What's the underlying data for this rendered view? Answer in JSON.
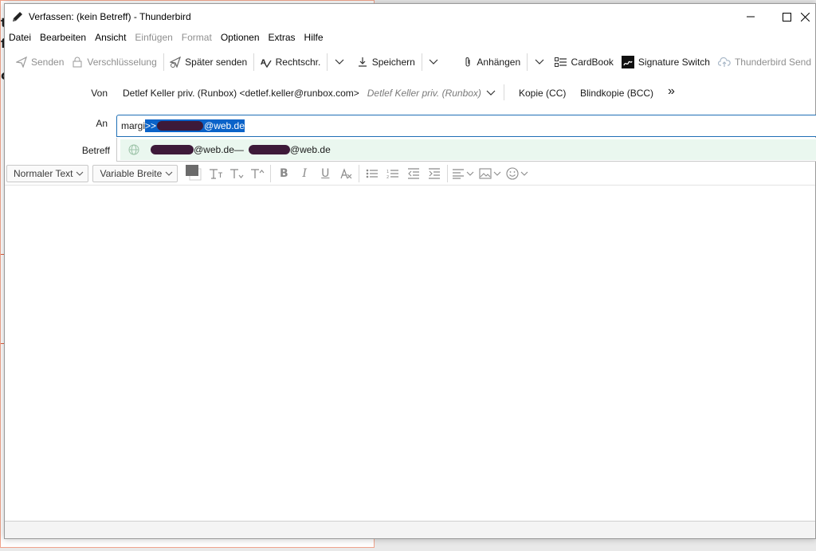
{
  "window": {
    "title": "Verfassen: (kein Betreff) - Thunderbird"
  },
  "menu": [
    {
      "label": "Datei",
      "enabled": true
    },
    {
      "label": "Bearbeiten",
      "enabled": true
    },
    {
      "label": "Ansicht",
      "enabled": true
    },
    {
      "label": "Einfügen",
      "enabled": false
    },
    {
      "label": "Format",
      "enabled": false
    },
    {
      "label": "Optionen",
      "enabled": true
    },
    {
      "label": "Extras",
      "enabled": true
    },
    {
      "label": "Hilfe",
      "enabled": true
    }
  ],
  "toolbar": {
    "send": "Senden",
    "encryption": "Verschlüsselung",
    "send_later": "Später senden",
    "spelling": "Rechtschr.",
    "save": "Speichern",
    "attach": "Anhängen",
    "cardbook": "CardBook",
    "signature_switch": "Signature Switch",
    "thunderbird_send": "Thunderbird Send"
  },
  "header": {
    "from_label": "Von",
    "from_identity": "Detlef Keller priv. (Runbox) <detlef.keller@runbox.com>",
    "from_identity_alt": "Detlef Keller priv. (Runbox)",
    "cc_label": "Kopie (CC)",
    "bcc_label": "Blindkopie (BCC)",
    "more_label": "»",
    "to_label": "An",
    "subject_label": "Betreff"
  },
  "to_field": {
    "typed": "margi",
    "completion_prefix": ">>",
    "completion_suffix": "@web.de"
  },
  "autocomplete": {
    "part1": "@web.de",
    "separator": "—",
    "part2": "@web.de"
  },
  "format": {
    "paragraph": "Normaler Text",
    "font": "Variable Breite"
  },
  "colors": {
    "accent": "#0a63c9",
    "redaction": "#3d1a39",
    "suggestion_bg": "#eaf7ef"
  }
}
